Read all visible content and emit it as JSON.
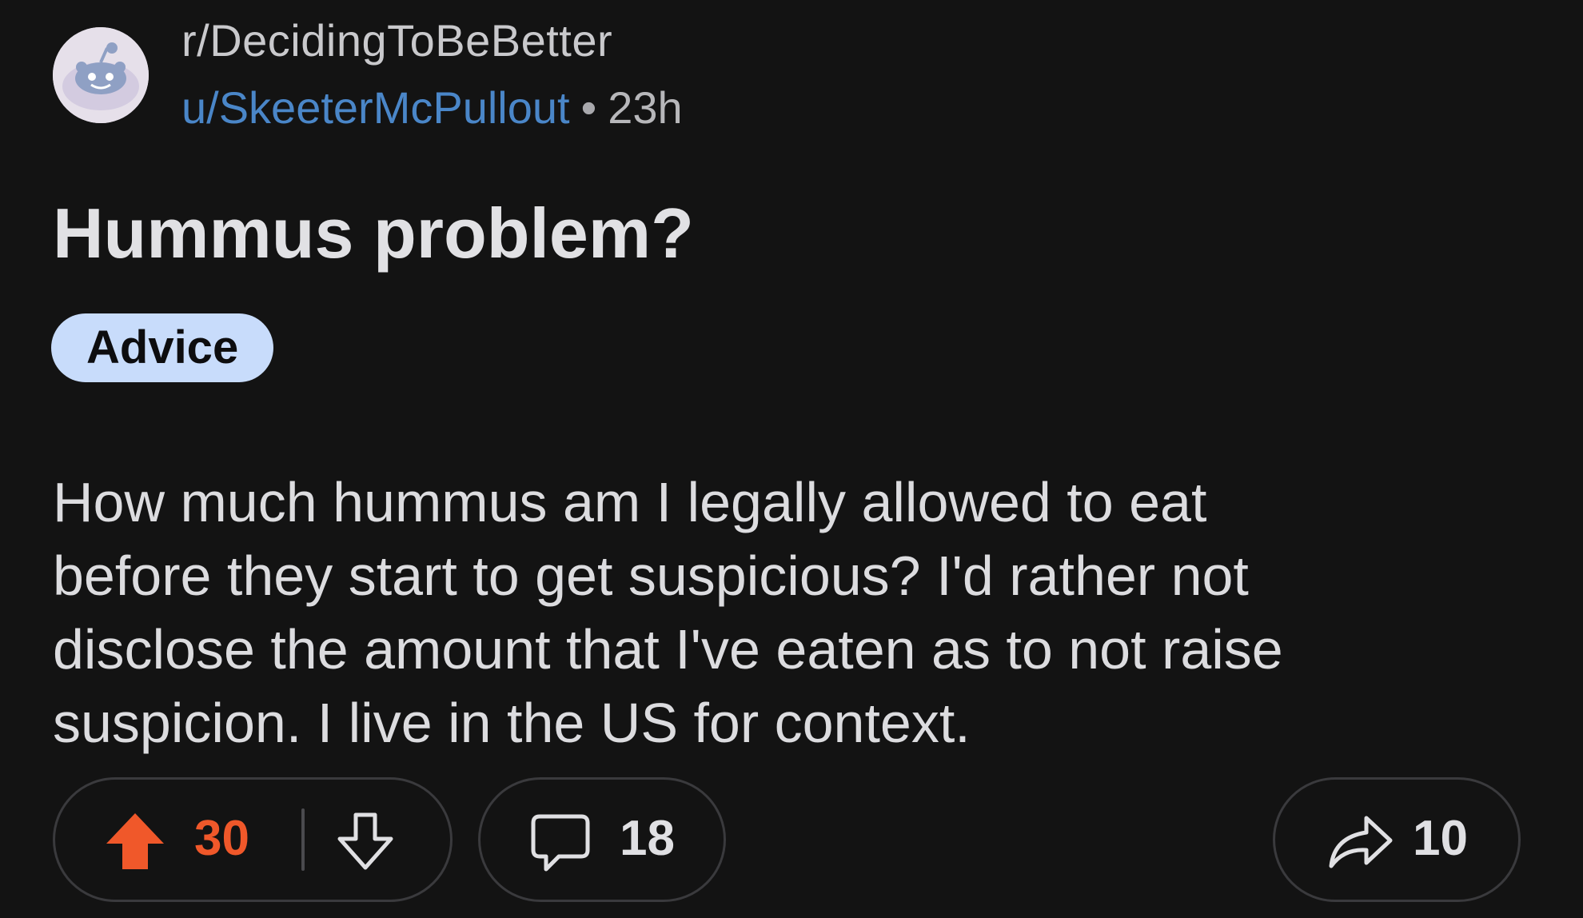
{
  "post": {
    "subreddit": "r/DecidingToBeBetter",
    "username": "u/SkeeterMcPullout",
    "separator": "•",
    "age": "23h",
    "title": "Hummus problem?",
    "flair": "Advice",
    "body_lines": [
      "How much hummus am I legally allowed to eat",
      "before they start to get suspicious? I'd rather not",
      "disclose the amount that I've eaten as to not raise",
      "suspicion. I live in the US for context."
    ]
  },
  "actions": {
    "upvotes": "30",
    "comments": "18",
    "shares": "10"
  },
  "colors": {
    "background": "#131313",
    "username": "#4a86c8",
    "flair_bg": "#c8dcfb",
    "upvote_active": "#f0582a"
  },
  "icons": {
    "avatar": "reddit-snoo-icon",
    "upvote": "upvote-arrow-filled-icon",
    "downvote": "downvote-arrow-outline-icon",
    "comment": "comment-bubble-icon",
    "share": "share-arrow-icon"
  }
}
